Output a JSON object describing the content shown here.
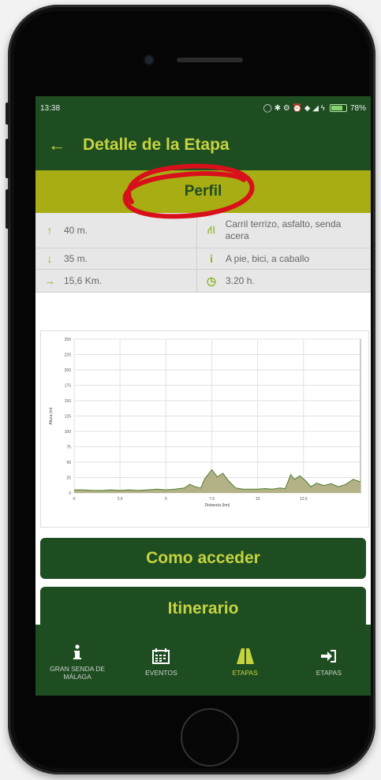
{
  "status": {
    "time": "13:38",
    "icons": "◯ ✱ ⚙ ⏰ ◆ ◢ ϟ",
    "battery": "78%",
    "battery_level": 0.78
  },
  "header": {
    "back_icon": "arrow-left-icon",
    "title": "Detalle de la Etapa"
  },
  "section": {
    "title": "Perfil",
    "annotation_color": "#d8101c"
  },
  "info": {
    "ascent": "40 m.",
    "surface": "Carril terrizo, asfalto, senda acera",
    "descent": "35 m.",
    "modes": "A pie, bici, a caballo",
    "distance": "15,6 Km.",
    "duration": "3.20 h."
  },
  "chart_data": {
    "type": "area",
    "xlabel": "Distancia (km)",
    "ylabel": "Altura (m)",
    "xlim": [
      0,
      15.6
    ],
    "ylim": [
      0,
      200
    ],
    "x_ticks": [
      "0",
      "2.5",
      "5",
      "7.5",
      "10",
      "12.5"
    ],
    "x_tick_values": [
      0,
      2.5,
      5,
      7.5,
      10,
      12.5
    ],
    "y_ticks": [
      "0",
      "25",
      "50",
      "75",
      "100",
      "125",
      "150",
      "175",
      "200",
      "225",
      "250"
    ],
    "y_tick_values": [
      0,
      25,
      50,
      75,
      100,
      125,
      150,
      175,
      200,
      225,
      250
    ],
    "grid": true,
    "fill_color": "#b3b186",
    "line_color": "#4e7d2e",
    "x": [
      0,
      0.5,
      1,
      1.5,
      2,
      2.5,
      3,
      3.5,
      4,
      4.5,
      5,
      5.5,
      6,
      6.3,
      6.6,
      6.9,
      7.1,
      7.3,
      7.5,
      7.8,
      8.1,
      8.4,
      8.8,
      9.2,
      9.6,
      10,
      10.4,
      10.8,
      11.2,
      11.5,
      11.8,
      12,
      12.3,
      12.6,
      12.9,
      13.2,
      13.6,
      14,
      14.4,
      14.8,
      15.2,
      15.6
    ],
    "y": [
      5,
      5,
      4,
      4,
      5,
      4,
      5,
      4,
      5,
      6,
      5,
      6,
      8,
      14,
      10,
      8,
      22,
      30,
      38,
      26,
      32,
      20,
      8,
      6,
      6,
      6,
      7,
      6,
      8,
      7,
      30,
      22,
      28,
      20,
      10,
      16,
      12,
      15,
      10,
      14,
      22,
      18
    ]
  },
  "buttons": {
    "acceder": "Como acceder",
    "itinerario": "Itinerario"
  },
  "nav": [
    {
      "label": "GRAN SENDA DE MÁLAGA",
      "icon": "info-icon"
    },
    {
      "label": "EVENTOS",
      "icon": "calendar-icon"
    },
    {
      "label": "ETAPAS",
      "icon": "road-icon"
    },
    {
      "label": "ETAPAS",
      "icon": "login-icon"
    }
  ]
}
